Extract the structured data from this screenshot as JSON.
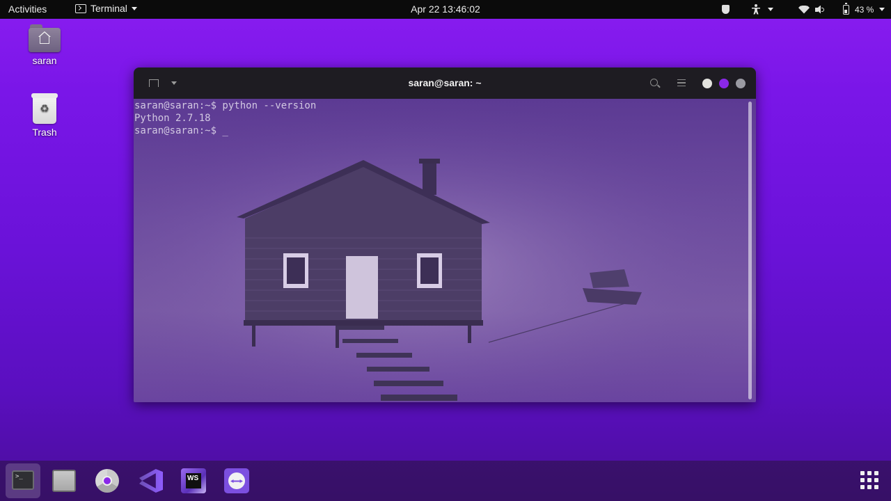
{
  "topbar": {
    "activities": "Activities",
    "app_name": "Terminal",
    "clock": "Apr 22  13:46:02",
    "battery_pct": "43 %"
  },
  "desktop": {
    "icons": [
      {
        "label": "saran",
        "icon": "home-folder-icon"
      },
      {
        "label": "Trash",
        "icon": "trash-icon"
      }
    ]
  },
  "window": {
    "title": "saran@saran: ~",
    "lines": [
      "saran@saran:~$ python --version",
      "Python 2.7.18",
      "saran@saran:~$ _"
    ]
  },
  "dock": {
    "apps": [
      "terminal-icon",
      "files-icon",
      "chrome-icon",
      "vscode-icon",
      "webstorm-icon",
      "teamviewer-icon"
    ],
    "webstorm_badge": "WS"
  },
  "colors": {
    "accent": "#8a28e8",
    "topbar": "#0b0b0b",
    "titlebar": "#1e1c22"
  }
}
